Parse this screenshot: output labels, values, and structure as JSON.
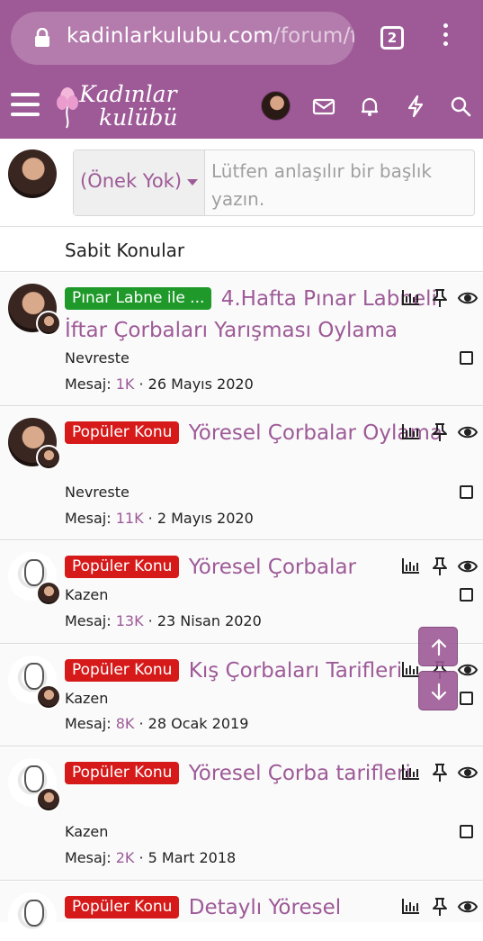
{
  "browser": {
    "url_host": "kadinlarkulubu.com",
    "url_path": "/forum/fo",
    "tab_count": "2"
  },
  "site": {
    "logo_line1": "Kadınlar",
    "logo_line2": "kulübü",
    "accent_color": "#9d5a97"
  },
  "composer": {
    "prefix_label": "(Önek Yok)",
    "title_placeholder": "Lütfen anlaşılır bir başlık yazın."
  },
  "sticky_header": "Sabit Konular",
  "threads": [
    {
      "badge": "Pınar Labne ile ...",
      "badge_color": "green",
      "title": "4.Hafta Pınar Labneli İftar Çorbaları Yarışması Oylama",
      "author": "Nevreste",
      "meta_label": "Mesaj:",
      "replies": "1K",
      "date": "26 Mayıs 2020"
    },
    {
      "badge": "Popüler Konu",
      "badge_color": "red",
      "title": "Yöresel Çorbalar Oylama",
      "author": "Nevreste",
      "meta_label": "Mesaj:",
      "replies": "11K",
      "date": "2 Mayıs 2020"
    },
    {
      "badge": "Popüler Konu",
      "badge_color": "red",
      "title": "Yöresel Çorbalar",
      "author": "Kazen",
      "meta_label": "Mesaj:",
      "replies": "13K",
      "date": "23 Nisan 2020"
    },
    {
      "badge": "Popüler Konu",
      "badge_color": "red",
      "title": "Kış Çorbaları Tarifleri",
      "author": "Kazen",
      "meta_label": "Mesaj:",
      "replies": "8K",
      "date": "28 Ocak 2019"
    },
    {
      "badge": "Popüler Konu",
      "badge_color": "red",
      "title": "Yöresel Çorba tarifleri",
      "author": "Kazen",
      "meta_label": "Mesaj:",
      "replies": "2K",
      "date": "5 Mart 2018"
    },
    {
      "badge": "Popüler Konu",
      "badge_color": "red",
      "title": "Detaylı Yöresel"
    }
  ],
  "icons": {
    "header": [
      "menu-icon",
      "avatar",
      "mail-icon",
      "bell-icon",
      "lightning-icon",
      "search-icon"
    ],
    "thread_row": [
      "chart-icon",
      "pin-icon",
      "eye-icon",
      "checkbox"
    ],
    "scroll": [
      "arrow-up-icon",
      "arrow-down-icon"
    ]
  }
}
